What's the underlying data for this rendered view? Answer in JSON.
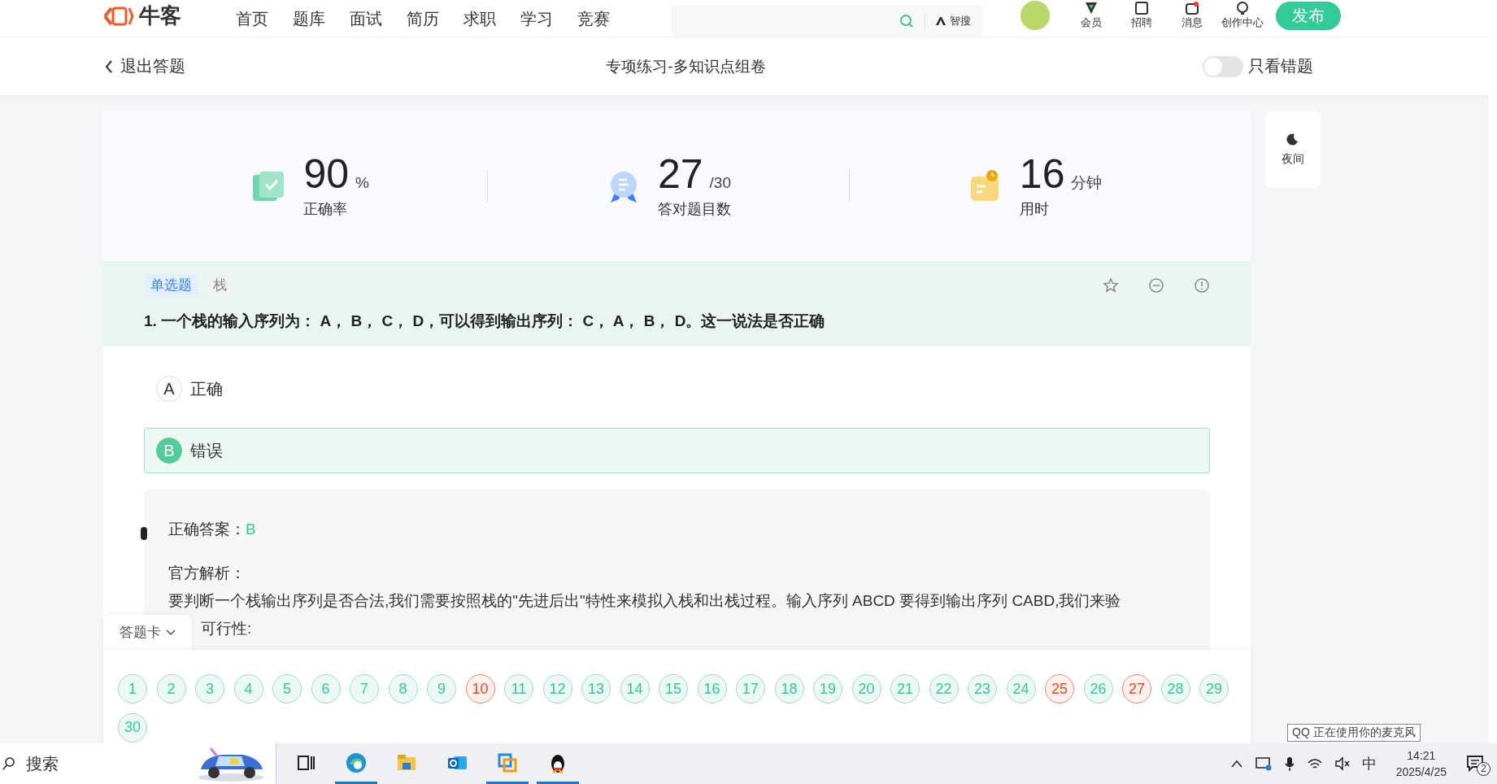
{
  "header": {
    "logo": "牛客",
    "nav": [
      {
        "label": "首页"
      },
      {
        "label": "题库"
      },
      {
        "label": "面试"
      },
      {
        "label": "简历"
      },
      {
        "label": "求职"
      },
      {
        "label": "学习"
      },
      {
        "label": "竞赛"
      }
    ],
    "search_button": "智搜",
    "actions": [
      {
        "label": "会员",
        "kind": "vip"
      },
      {
        "label": "招聘",
        "kind": "jobs"
      },
      {
        "label": "消息",
        "kind": "message"
      },
      {
        "label": "创作中心",
        "kind": "create"
      }
    ],
    "publish": "发布"
  },
  "subbar": {
    "back": "退出答题",
    "title": "专项练习-多知识点组卷",
    "toggle": {
      "label": "只看错题",
      "on": false
    }
  },
  "stats": [
    {
      "kind": "accuracy",
      "value": "90",
      "unit": "%",
      "label": "正确率"
    },
    {
      "kind": "count",
      "value": "27",
      "unit": "/30",
      "label": "答对题目数"
    },
    {
      "kind": "time",
      "value": "16",
      "unit": "分钟",
      "label": "用时"
    }
  ],
  "night_button": "夜间",
  "question": {
    "type_tag": "单选题",
    "topic_tag": "栈",
    "text": "1. 一个栈的输入序列为： A， B， C， D，可以得到输出序列： C， A， B， D。这一说法是否正确",
    "options": [
      {
        "letter": "A",
        "text": "正确",
        "selected": false
      },
      {
        "letter": "B",
        "text": "错误",
        "selected": true
      }
    ]
  },
  "analysis": {
    "answer_label": "正确答案：",
    "answer": "B",
    "title": "官方解析：",
    "text": "要判断一个栈输出序列是否合法,我们需要按照栈的\"先进后出\"特性来模拟入栈和出栈过程。输入序列 ABCD 要得到输出序列 CABD,我们来验",
    "text_cont": "可行性:"
  },
  "answer_card": {
    "label": "答题卡",
    "items": [
      {
        "n": "1",
        "correct": true
      },
      {
        "n": "2",
        "correct": true
      },
      {
        "n": "3",
        "correct": true
      },
      {
        "n": "4",
        "correct": true
      },
      {
        "n": "5",
        "correct": true
      },
      {
        "n": "6",
        "correct": true
      },
      {
        "n": "7",
        "correct": true
      },
      {
        "n": "8",
        "correct": true
      },
      {
        "n": "9",
        "correct": true
      },
      {
        "n": "10",
        "correct": false
      },
      {
        "n": "11",
        "correct": true
      },
      {
        "n": "12",
        "correct": true
      },
      {
        "n": "13",
        "correct": true
      },
      {
        "n": "14",
        "correct": true
      },
      {
        "n": "15",
        "correct": true
      },
      {
        "n": "16",
        "correct": true
      },
      {
        "n": "17",
        "correct": true
      },
      {
        "n": "18",
        "correct": true
      },
      {
        "n": "19",
        "correct": true
      },
      {
        "n": "20",
        "correct": true
      },
      {
        "n": "21",
        "correct": true
      },
      {
        "n": "22",
        "correct": true
      },
      {
        "n": "23",
        "correct": true
      },
      {
        "n": "24",
        "correct": true
      },
      {
        "n": "25",
        "correct": false
      },
      {
        "n": "26",
        "correct": true
      },
      {
        "n": "27",
        "correct": false
      },
      {
        "n": "28",
        "correct": true
      },
      {
        "n": "29",
        "correct": true
      },
      {
        "n": "30",
        "correct": true
      }
    ]
  },
  "tooltip": "QQ 正在使用你的麦克风",
  "taskbar": {
    "search": "搜索",
    "apps": [
      {
        "kind": "taskview",
        "selected": false
      },
      {
        "kind": "edge",
        "selected": true
      },
      {
        "kind": "files",
        "selected": false
      },
      {
        "kind": "outlook",
        "selected": false
      },
      {
        "kind": "vmware",
        "selected": true
      },
      {
        "kind": "qq",
        "selected": true
      }
    ],
    "ime": "中",
    "time": "14:21",
    "date": "2025/4/25",
    "notifications": "2"
  }
}
